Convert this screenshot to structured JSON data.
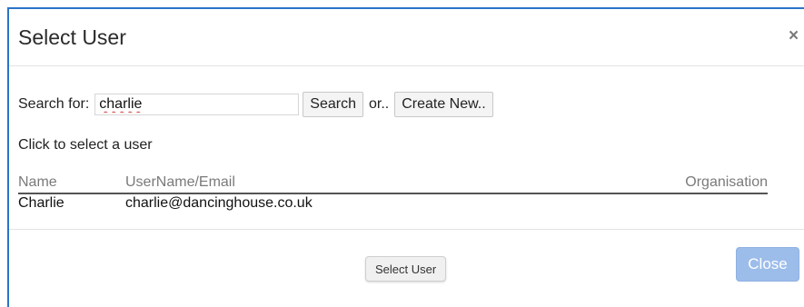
{
  "dialog": {
    "title": "Select User",
    "close_glyph": "×"
  },
  "search": {
    "label": "Search for:",
    "value": "charlie",
    "search_button": "Search",
    "or_text": "or..",
    "create_button": "Create New.."
  },
  "hint": "Click to select a user",
  "table": {
    "headers": {
      "name": "Name",
      "email": "UserName/Email",
      "organisation": "Organisation"
    },
    "rows": [
      {
        "name": "Charlie",
        "email": "charlie@dancinghouse.co.uk",
        "organisation": ""
      }
    ]
  },
  "footer": {
    "select_button": "Select User",
    "close_button": "Close"
  },
  "colors": {
    "border_accent": "#2a74c9",
    "close_button_bg": "#9cbdea",
    "spellcheck_underline": "#d9534f"
  }
}
